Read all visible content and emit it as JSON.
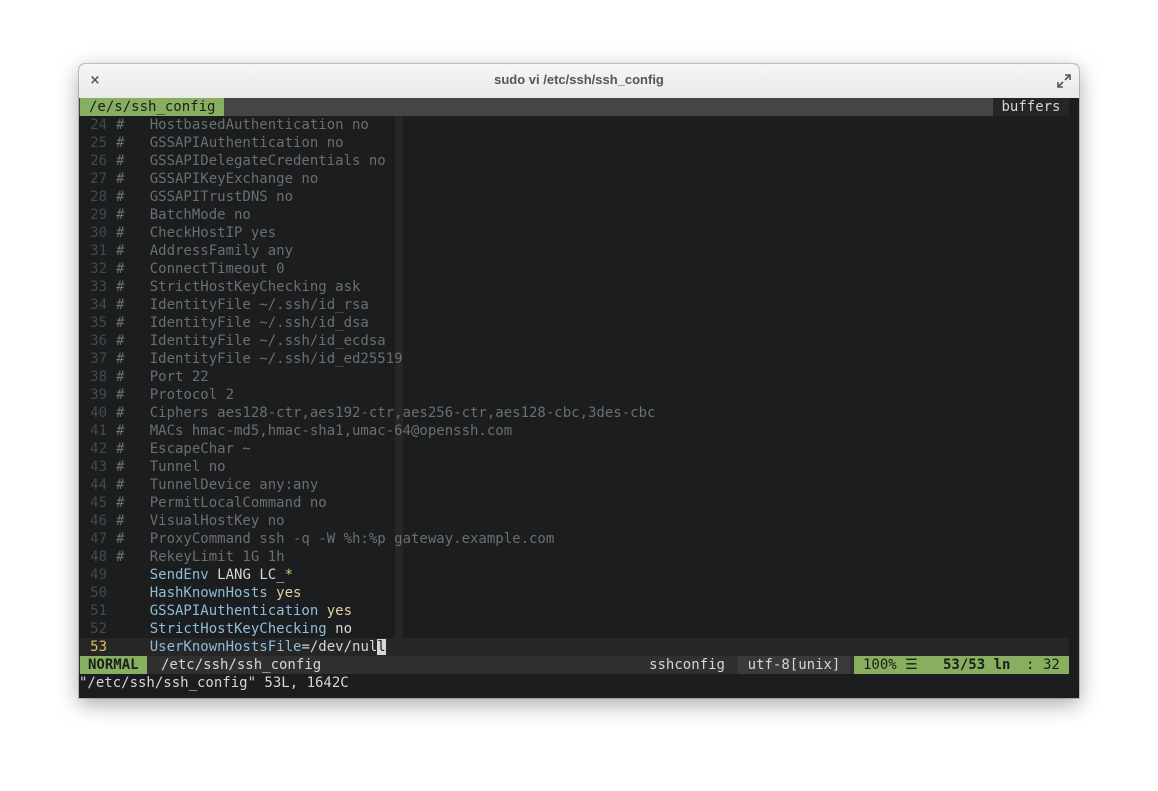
{
  "window": {
    "title": "sudo vi /etc/ssh/ssh_config",
    "close_glyph": "×"
  },
  "tabline": {
    "current_tab": "/e/s/ssh_config",
    "right_label": "buffers"
  },
  "lines": [
    {
      "n": "24",
      "text": "#   HostbasedAuthentication no",
      "type": "comment"
    },
    {
      "n": "25",
      "text": "#   GSSAPIAuthentication no",
      "type": "comment"
    },
    {
      "n": "26",
      "text": "#   GSSAPIDelegateCredentials no",
      "type": "comment"
    },
    {
      "n": "27",
      "text": "#   GSSAPIKeyExchange no",
      "type": "comment"
    },
    {
      "n": "28",
      "text": "#   GSSAPITrustDNS no",
      "type": "comment"
    },
    {
      "n": "29",
      "text": "#   BatchMode no",
      "type": "comment"
    },
    {
      "n": "30",
      "text": "#   CheckHostIP yes",
      "type": "comment"
    },
    {
      "n": "31",
      "text": "#   AddressFamily any",
      "type": "comment"
    },
    {
      "n": "32",
      "text": "#   ConnectTimeout 0",
      "type": "comment"
    },
    {
      "n": "33",
      "text": "#   StrictHostKeyChecking ask",
      "type": "comment"
    },
    {
      "n": "34",
      "text": "#   IdentityFile ~/.ssh/id_rsa",
      "type": "comment"
    },
    {
      "n": "35",
      "text": "#   IdentityFile ~/.ssh/id_dsa",
      "type": "comment"
    },
    {
      "n": "36",
      "text": "#   IdentityFile ~/.ssh/id_ecdsa",
      "type": "comment"
    },
    {
      "n": "37",
      "text": "#   IdentityFile ~/.ssh/id_ed25519",
      "type": "comment"
    },
    {
      "n": "38",
      "text": "#   Port 22",
      "type": "comment"
    },
    {
      "n": "39",
      "text": "#   Protocol 2",
      "type": "comment"
    },
    {
      "n": "40",
      "text": "#   Ciphers aes128-ctr,aes192-ctr,aes256-ctr,aes128-cbc,3des-cbc",
      "type": "comment"
    },
    {
      "n": "41",
      "text": "#   MACs hmac-md5,hmac-sha1,umac-64@openssh.com",
      "type": "comment"
    },
    {
      "n": "42",
      "text": "#   EscapeChar ~",
      "type": "comment"
    },
    {
      "n": "43",
      "text": "#   Tunnel no",
      "type": "comment"
    },
    {
      "n": "44",
      "text": "#   TunnelDevice any:any",
      "type": "comment"
    },
    {
      "n": "45",
      "text": "#   PermitLocalCommand no",
      "type": "comment"
    },
    {
      "n": "46",
      "text": "#   VisualHostKey no",
      "type": "comment"
    },
    {
      "n": "47",
      "text": "#   ProxyCommand ssh -q -W %h:%p gateway.example.com",
      "type": "comment"
    },
    {
      "n": "48",
      "text": "#   RekeyLimit 1G 1h",
      "type": "comment"
    },
    {
      "n": "49",
      "key": "SendEnv",
      "value": "LANG LC_",
      "special": "*",
      "type": "directive"
    },
    {
      "n": "50",
      "key": "HashKnownHosts",
      "value": "yes",
      "type": "directive-val"
    },
    {
      "n": "51",
      "key": "GSSAPIAuthentication",
      "value": "yes",
      "type": "directive-val"
    },
    {
      "n": "52",
      "key": "StrictHostKeyChecking",
      "value": "no",
      "type": "directive-plain"
    },
    {
      "n": "53",
      "key": "UserKnownHostsFile",
      "value": "=/dev/nul",
      "cursor_char": "l",
      "type": "current"
    }
  ],
  "statusline": {
    "mode": "NORMAL",
    "filename": "/etc/ssh/ssh_config",
    "filetype": "sshconfig",
    "encoding": "utf-8[unix]",
    "percent": "100% ☰",
    "line_info": "53/53 ln",
    "col_sep": ":",
    "col": "32"
  },
  "cmdline": {
    "text": "\"/etc/ssh/ssh_config\" 53L, 1642C"
  },
  "colors": {
    "accent_green": "#87af5f",
    "background": "#1b1d1e",
    "comment": "#6b6f72",
    "keyword": "#8fbcd8",
    "value": "#e6d0a0",
    "line_number_current": "#e0c060"
  }
}
